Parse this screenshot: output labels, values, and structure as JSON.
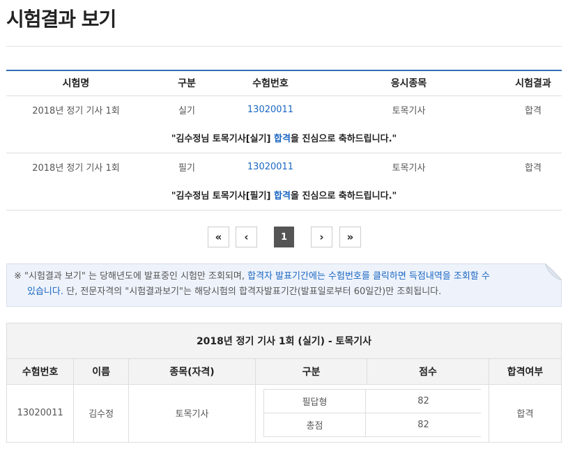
{
  "page_title": "시험결과 보기",
  "results": {
    "headers": [
      "시험명",
      "구분",
      "수험번호",
      "응시종목",
      "시험결과"
    ],
    "rows": [
      {
        "exam_name": "2018년 정기 기사 1회",
        "type": "실기",
        "exam_no": "13020011",
        "subject": "토목기사",
        "result": "합격",
        "msg_pre": "\"김수정님 토목기사[실기] ",
        "msg_hl": "합격",
        "msg_post": "을 진심으로 축하드립니다.\""
      },
      {
        "exam_name": "2018년 정기 기사 1회",
        "type": "필기",
        "exam_no": "13020011",
        "subject": "토목기사",
        "result": "합격",
        "msg_pre": "\"김수정님 토목기사[필기] ",
        "msg_hl": "합격",
        "msg_post": "을 진심으로 축하드립니다.\""
      }
    ]
  },
  "pagination": {
    "first": "«",
    "prev": "‹",
    "current": "1",
    "next": "›",
    "last": "»"
  },
  "notice": {
    "prefix": "※ \"시험결과 보기\" 는 당해년도에 발표중인 시험만 조회되며, ",
    "highlight1": "합격자 발표기간에는 수험번호를 클릭하면 득점내역을 조회할 수",
    "highlight2": "있습니다.",
    "suffix": " 단, 전문자격의 \"시험결과보기\"는 해당시험의 합격자발표기간(발표일로부터 60일간)만 조회됩니다."
  },
  "detail": {
    "caption": "2018년 정기 기사 1회 (실기) - 토목기사",
    "headers": [
      "수험번호",
      "이름",
      "종목(자격)",
      "구분",
      "점수",
      "합격여부"
    ],
    "exam_no": "13020011",
    "name": "김수정",
    "subject": "토목기사",
    "scores": [
      {
        "category": "필답형",
        "score": "82"
      },
      {
        "category": "총점",
        "score": "82"
      }
    ],
    "result": "합격"
  },
  "colors": {
    "accent": "#1a66c2",
    "header_rule": "#2f6fb6",
    "notice_bg": "#eef3fb"
  }
}
